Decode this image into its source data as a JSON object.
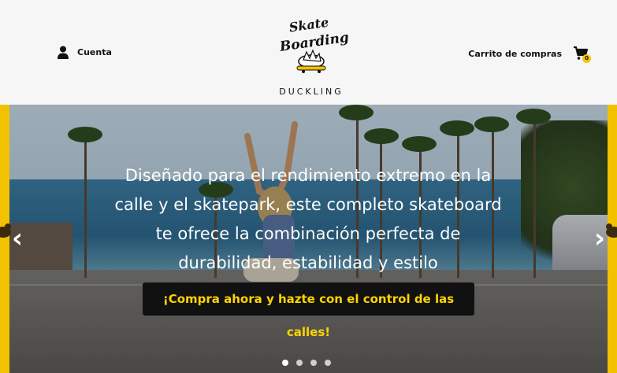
{
  "header": {
    "account_label": "Cuenta",
    "cart_label": "Carrito de compras",
    "cart_count": "0",
    "logo": {
      "line1": "Skate",
      "line2": "Boarding",
      "line3": "DUCKLING"
    }
  },
  "hero": {
    "headline": "Diseñado para el rendimiento extremo en la calle y el skatepark, este completo skateboard te ofrece la combinación perfecta de durabilidad, estabilidad y estilo",
    "cta_label": "¡Compra ahora y hazte con el control de las calles!",
    "prev_icon": "‹",
    "next_icon": "›",
    "slides_total": 4,
    "active_slide": 1
  },
  "colors": {
    "brand_yellow": "#f2c200",
    "cta_bg": "#111111",
    "cta_text": "#ffd400"
  }
}
